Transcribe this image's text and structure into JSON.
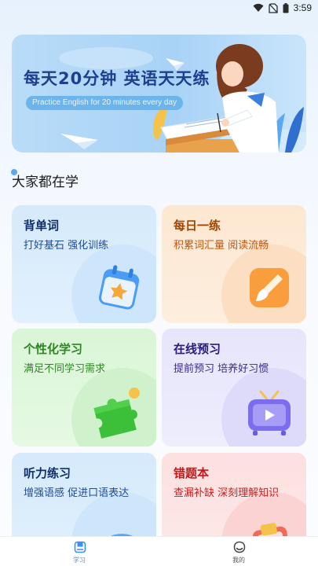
{
  "status_bar": {
    "time": "3:59",
    "icons": [
      "wifi-icon",
      "no-sim-icon",
      "battery-icon"
    ]
  },
  "banner": {
    "title": "每天20分钟 英语天天练",
    "subtitle": "Practice English for 20 minutes every day"
  },
  "section": {
    "title": "大家都在学"
  },
  "cards": [
    {
      "title": "背单词",
      "subtitle": "打好基石 强化训练",
      "icon": "calendar-star-icon",
      "accent": "#3b8ff0"
    },
    {
      "title": "每日一练",
      "subtitle": "积累词汇量 阅读流畅",
      "icon": "brush-icon",
      "accent": "#f7922f"
    },
    {
      "title": "个性化学习",
      "subtitle": "满足不同学习需求",
      "icon": "puzzle-icon",
      "accent": "#3cc03a"
    },
    {
      "title": "在线预习",
      "subtitle": "提前预习 培养好习惯",
      "icon": "video-play-icon",
      "accent": "#7b6cf0"
    },
    {
      "title": "听力练习",
      "subtitle": "增强语感 促进口语表达",
      "icon": "headphone-icon",
      "accent": "#3b8ff0"
    },
    {
      "title": "错题本",
      "subtitle": "查漏补缺 深刻理解知识",
      "icon": "error-book-icon",
      "accent": "#f06a5a"
    }
  ],
  "tabbar": {
    "items": [
      {
        "label": "学习",
        "icon": "study-icon",
        "active": true
      },
      {
        "label": "我的",
        "icon": "profile-icon",
        "active": false
      }
    ],
    "active_color": "#3d8ff0"
  }
}
